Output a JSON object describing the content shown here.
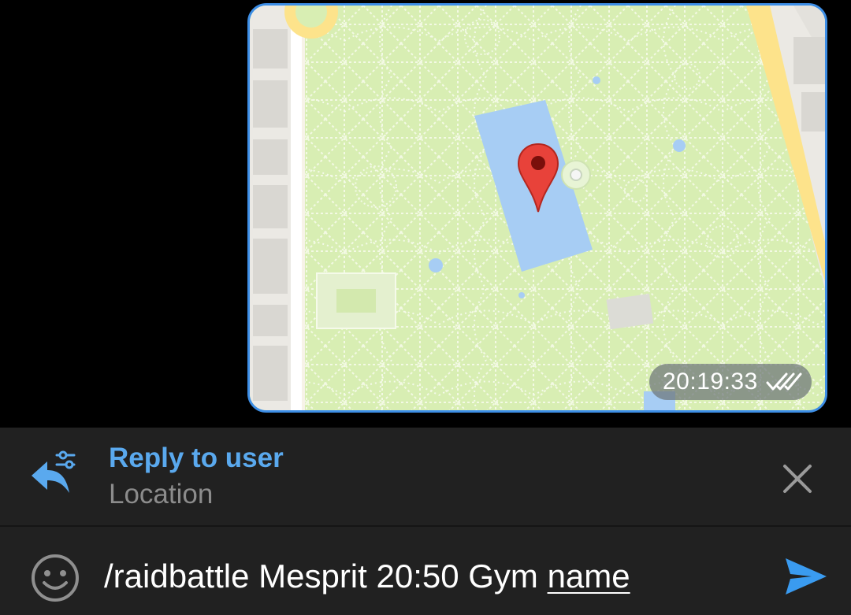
{
  "message": {
    "type": "location",
    "time": "20:19:33",
    "status": "double-check-icon",
    "bubble_border_color": "#3d8ee6",
    "map": {
      "park_color": "#d8eeb3",
      "water_color": "#a7cdf4",
      "road_color": "#fde38b",
      "marker_color": "#e8423a"
    }
  },
  "reply": {
    "title": "Reply to user",
    "subtitle": "Location",
    "icon": "reply-settings-icon",
    "close_icon": "close-icon",
    "accent_color": "#5aa9ee"
  },
  "composer": {
    "emoji_icon": "emoji-icon",
    "text_part": "/raidbattle Mesprit 20:50 Gym ",
    "underlined_part": "name",
    "send_icon": "send-icon",
    "send_color": "#3a9bf0"
  }
}
